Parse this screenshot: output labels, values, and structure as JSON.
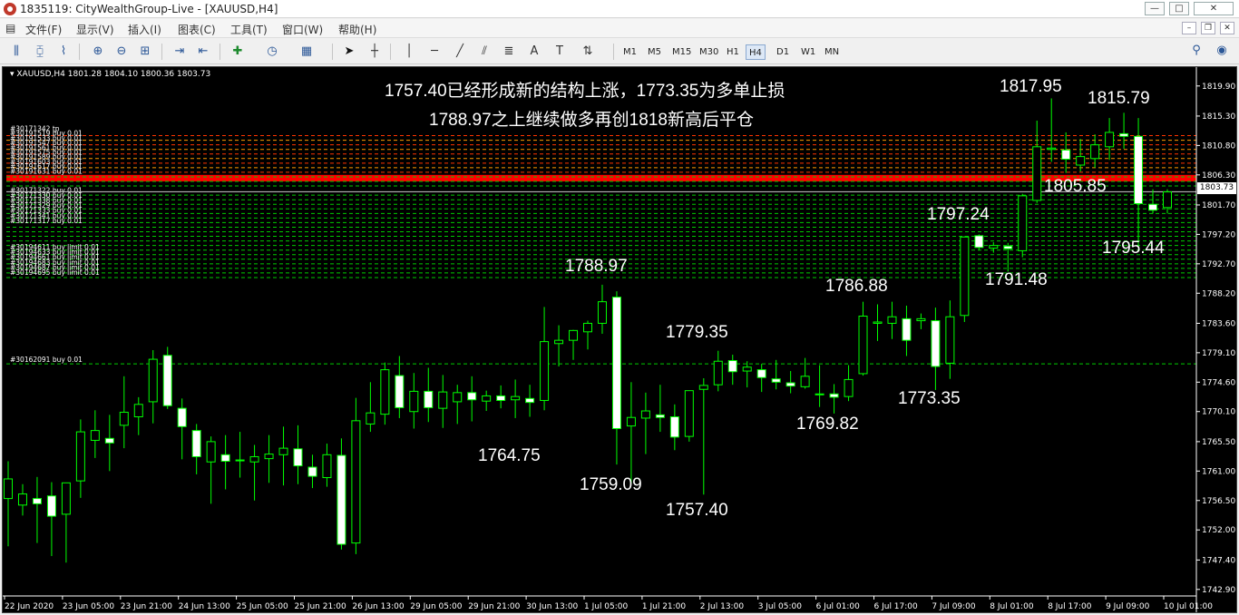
{
  "window": {
    "title": "1835119: CityWealthGroup-Live - [XAUUSD,H4]",
    "minimize_label": "—",
    "maximize_label": "□",
    "close_label": "✕"
  },
  "menu": {
    "items": [
      "文件(F)",
      "显示(V)",
      "插入(I)",
      "图表(C)",
      "工具(T)",
      "窗口(W)",
      "帮助(H)"
    ]
  },
  "toolbar": {
    "timeframes": [
      "M1",
      "M5",
      "M15",
      "M30",
      "H1",
      "H4",
      "D1",
      "W1",
      "MN"
    ],
    "active_timeframe": "H4"
  },
  "chart_header": {
    "symbol": "XAUUSD,H4",
    "ohlc": "1801.28 1804.10 1800.36 1803.73"
  },
  "current_price": "1803.73",
  "annotations": {
    "line1": "1757.40已经形成新的结构上涨，1773.35为多单止损",
    "line2": "1788.97之上继续做多再创1818新高后平仓"
  },
  "price_labels": [
    "1817.95",
    "1815.79",
    "1805.85",
    "1797.24",
    "1795.44",
    "1791.48",
    "1786.88",
    "1788.97",
    "1779.35",
    "1773.35",
    "1769.82",
    "1764.75",
    "1759.09",
    "1757.40"
  ],
  "order_lines": {
    "tp_top": "#30171342 tp",
    "sells": [
      "#30191519 buy 0.01",
      "#30191533 buy 0.01",
      "#30191547 buy 0.01",
      "#30191561 buy 0.01",
      "#30191575 buy 0.01",
      "#30191589 buy 0.01",
      "#30191603 buy 0.01",
      "#30191617 buy 0.01",
      "#30191631 buy 0.01"
    ],
    "buys": [
      "#30171322 buy 0.01",
      "#30171330 buy 0.01",
      "#30171338 buy 0.01",
      "#30171329 buy 0.01",
      "#30171333 buy 0.01",
      "#30171341 buy 0.01",
      "#30171317 buy 0.01"
    ],
    "limits": [
      "#30194611 buy limit 0.01",
      "#30194633 buy limit 0.01",
      "#30194661 buy limit 0.01",
      "#30194683 buy limit 0.01",
      "#30194687 buy limit 0.01",
      "#30194695 buy limit 0.01"
    ],
    "lone": "#30162091 buy 0.01"
  },
  "chart_data": {
    "type": "candlestick",
    "symbol": "XAUUSD",
    "timeframe": "H4",
    "ylim": [
      1742.9,
      1822.0
    ],
    "y_ticks": [
      "1819.90",
      "1815.30",
      "1810.80",
      "1806.30",
      "1801.70",
      "1797.20",
      "1792.70",
      "1788.20",
      "1783.60",
      "1779.10",
      "1774.60",
      "1770.10",
      "1765.50",
      "1761.00",
      "1756.50",
      "1752.00",
      "1747.40",
      "1742.90"
    ],
    "x_ticks": [
      "22 Jun 2020",
      "23 Jun 05:00",
      "23 Jun 21:00",
      "24 Jun 13:00",
      "25 Jun 05:00",
      "25 Jun 21:00",
      "26 Jun 13:00",
      "29 Jun 05:00",
      "29 Jun 21:00",
      "30 Jun 13:00",
      "1 Jul 05:00",
      "1 Jul 21:00",
      "2 Jul 13:00",
      "3 Jul 05:00",
      "6 Jul 01:00",
      "6 Jul 17:00",
      "7 Jul 09:00",
      "8 Jul 01:00",
      "8 Jul 17:00",
      "9 Jul 09:00",
      "10 Jul 01:00"
    ],
    "order_levels": [
      1812.3,
      1811.6,
      1810.9,
      1810.2,
      1809.5,
      1808.8,
      1808.1,
      1807.4,
      1806.7,
      1806.0,
      1805.3,
      1804.6,
      1803.2,
      1802.5,
      1801.8,
      1801.1,
      1800.4,
      1799.7,
      1799.0,
      1798.3,
      1797.6,
      1796.9,
      1796.2,
      1795.5,
      1794.8,
      1794.1,
      1793.4,
      1792.7,
      1792.0,
      1791.3,
      1790.6,
      1777.4
    ],
    "red_band": [
      1805.3,
      1806.3
    ],
    "candles": [
      {
        "o": 1756.8,
        "h": 1762.5,
        "l": 1749.5,
        "c": 1759.8
      },
      {
        "o": 1755.8,
        "h": 1759.0,
        "l": 1754.2,
        "c": 1757.5
      },
      {
        "o": 1756.8,
        "h": 1760.1,
        "l": 1750.0,
        "c": 1756.0
      },
      {
        "o": 1757.2,
        "h": 1759.3,
        "l": 1748.0,
        "c": 1754.1
      },
      {
        "o": 1754.4,
        "h": 1759.0,
        "l": 1747.0,
        "c": 1759.2
      },
      {
        "o": 1759.5,
        "h": 1768.9,
        "l": 1756.9,
        "c": 1767.0
      },
      {
        "o": 1765.7,
        "h": 1770.3,
        "l": 1763.0,
        "c": 1767.2
      },
      {
        "o": 1766.0,
        "h": 1769.6,
        "l": 1761.0,
        "c": 1765.3
      },
      {
        "o": 1768.0,
        "h": 1775.5,
        "l": 1764.5,
        "c": 1770.0
      },
      {
        "o": 1769.3,
        "h": 1772.3,
        "l": 1766.5,
        "c": 1771.2
      },
      {
        "o": 1771.6,
        "h": 1779.5,
        "l": 1768.3,
        "c": 1778.1
      },
      {
        "o": 1778.7,
        "h": 1780.0,
        "l": 1770.5,
        "c": 1771.0
      },
      {
        "o": 1770.6,
        "h": 1772.1,
        "l": 1762.8,
        "c": 1767.8
      },
      {
        "o": 1767.2,
        "h": 1768.2,
        "l": 1760.5,
        "c": 1763.2
      },
      {
        "o": 1762.4,
        "h": 1766.3,
        "l": 1756.0,
        "c": 1765.5
      },
      {
        "o": 1763.5,
        "h": 1766.5,
        "l": 1758.2,
        "c": 1762.5
      },
      {
        "o": 1762.7,
        "h": 1767.0,
        "l": 1760.0,
        "c": 1762.6
      },
      {
        "o": 1762.4,
        "h": 1765.0,
        "l": 1756.5,
        "c": 1763.2
      },
      {
        "o": 1762.9,
        "h": 1766.5,
        "l": 1759.2,
        "c": 1763.6
      },
      {
        "o": 1763.5,
        "h": 1767.8,
        "l": 1758.8,
        "c": 1764.5
      },
      {
        "o": 1764.4,
        "h": 1768.0,
        "l": 1759.0,
        "c": 1761.8
      },
      {
        "o": 1761.6,
        "h": 1763.5,
        "l": 1758.4,
        "c": 1760.2
      },
      {
        "o": 1760.0,
        "h": 1765.2,
        "l": 1758.6,
        "c": 1763.5
      },
      {
        "o": 1763.4,
        "h": 1766.0,
        "l": 1749.0,
        "c": 1749.8
      },
      {
        "o": 1750.0,
        "h": 1772.2,
        "l": 1748.3,
        "c": 1768.7
      },
      {
        "o": 1768.2,
        "h": 1774.6,
        "l": 1767.0,
        "c": 1769.9
      },
      {
        "o": 1769.7,
        "h": 1777.6,
        "l": 1768.1,
        "c": 1776.5
      },
      {
        "o": 1775.6,
        "h": 1778.6,
        "l": 1769.1,
        "c": 1770.7
      },
      {
        "o": 1770.1,
        "h": 1776.0,
        "l": 1767.5,
        "c": 1773.2
      },
      {
        "o": 1773.2,
        "h": 1776.8,
        "l": 1768.5,
        "c": 1770.7
      },
      {
        "o": 1770.6,
        "h": 1775.7,
        "l": 1767.6,
        "c": 1773.1
      },
      {
        "o": 1771.6,
        "h": 1774.2,
        "l": 1768.2,
        "c": 1773.0
      },
      {
        "o": 1773.0,
        "h": 1775.5,
        "l": 1768.6,
        "c": 1771.9
      },
      {
        "o": 1771.7,
        "h": 1773.3,
        "l": 1770.2,
        "c": 1772.5
      },
      {
        "o": 1772.5,
        "h": 1774.1,
        "l": 1770.6,
        "c": 1771.8
      },
      {
        "o": 1771.9,
        "h": 1775.0,
        "l": 1769.1,
        "c": 1772.4
      },
      {
        "o": 1772.1,
        "h": 1774.2,
        "l": 1769.3,
        "c": 1771.5
      },
      {
        "o": 1771.8,
        "h": 1786.1,
        "l": 1770.3,
        "c": 1780.8
      },
      {
        "o": 1780.5,
        "h": 1783.3,
        "l": 1777.0,
        "c": 1781.0
      },
      {
        "o": 1781.0,
        "h": 1782.6,
        "l": 1778.0,
        "c": 1782.5
      },
      {
        "o": 1782.3,
        "h": 1784.0,
        "l": 1779.6,
        "c": 1783.6
      },
      {
        "o": 1783.6,
        "h": 1789.5,
        "l": 1782.0,
        "c": 1786.9
      },
      {
        "o": 1787.6,
        "h": 1788.5,
        "l": 1762.0,
        "c": 1767.5
      },
      {
        "o": 1767.9,
        "h": 1774.6,
        "l": 1759.1,
        "c": 1769.2
      },
      {
        "o": 1769.1,
        "h": 1773.0,
        "l": 1763.6,
        "c": 1770.2
      },
      {
        "o": 1769.6,
        "h": 1774.2,
        "l": 1767.0,
        "c": 1769.2
      },
      {
        "o": 1769.3,
        "h": 1771.2,
        "l": 1764.2,
        "c": 1766.2
      },
      {
        "o": 1766.3,
        "h": 1773.0,
        "l": 1765.5,
        "c": 1773.3
      },
      {
        "o": 1773.5,
        "h": 1775.2,
        "l": 1757.4,
        "c": 1774.1
      },
      {
        "o": 1774.2,
        "h": 1779.4,
        "l": 1773.2,
        "c": 1777.8
      },
      {
        "o": 1777.9,
        "h": 1778.8,
        "l": 1774.2,
        "c": 1776.2
      },
      {
        "o": 1776.3,
        "h": 1777.8,
        "l": 1773.8,
        "c": 1776.9
      },
      {
        "o": 1776.5,
        "h": 1777.4,
        "l": 1773.1,
        "c": 1775.3
      },
      {
        "o": 1775.1,
        "h": 1778.0,
        "l": 1773.5,
        "c": 1774.6
      },
      {
        "o": 1774.5,
        "h": 1776.3,
        "l": 1772.9,
        "c": 1774.0
      },
      {
        "o": 1773.9,
        "h": 1778.3,
        "l": 1773.6,
        "c": 1775.5
      },
      {
        "o": 1772.8,
        "h": 1777.2,
        "l": 1770.8,
        "c": 1772.7
      },
      {
        "o": 1772.8,
        "h": 1774.3,
        "l": 1769.8,
        "c": 1772.3
      },
      {
        "o": 1772.4,
        "h": 1777.2,
        "l": 1771.7,
        "c": 1775.0
      },
      {
        "o": 1775.9,
        "h": 1786.9,
        "l": 1775.6,
        "c": 1784.7
      },
      {
        "o": 1783.6,
        "h": 1786.5,
        "l": 1780.9,
        "c": 1783.8
      },
      {
        "o": 1783.6,
        "h": 1786.9,
        "l": 1781.2,
        "c": 1784.6
      },
      {
        "o": 1784.3,
        "h": 1786.3,
        "l": 1778.6,
        "c": 1781.0
      },
      {
        "o": 1784.0,
        "h": 1785.1,
        "l": 1782.7,
        "c": 1784.3
      },
      {
        "o": 1784.0,
        "h": 1786.0,
        "l": 1773.4,
        "c": 1777.0
      },
      {
        "o": 1777.5,
        "h": 1787.1,
        "l": 1775.1,
        "c": 1784.6
      },
      {
        "o": 1784.8,
        "h": 1796.9,
        "l": 1783.8,
        "c": 1796.8
      },
      {
        "o": 1797.0,
        "h": 1797.2,
        "l": 1794.8,
        "c": 1795.2
      },
      {
        "o": 1795.1,
        "h": 1796.0,
        "l": 1794.4,
        "c": 1795.5
      },
      {
        "o": 1795.4,
        "h": 1795.9,
        "l": 1791.5,
        "c": 1795.0
      },
      {
        "o": 1794.7,
        "h": 1803.4,
        "l": 1793.7,
        "c": 1803.1
      },
      {
        "o": 1802.4,
        "h": 1814.6,
        "l": 1802.0,
        "c": 1810.6
      },
      {
        "o": 1810.2,
        "h": 1818.0,
        "l": 1808.3,
        "c": 1810.4
      },
      {
        "o": 1810.1,
        "h": 1812.8,
        "l": 1806.6,
        "c": 1808.7
      },
      {
        "o": 1807.8,
        "h": 1811.8,
        "l": 1806.8,
        "c": 1809.1
      },
      {
        "o": 1808.8,
        "h": 1812.5,
        "l": 1807.4,
        "c": 1810.9
      },
      {
        "o": 1810.6,
        "h": 1815.0,
        "l": 1808.6,
        "c": 1812.8
      },
      {
        "o": 1812.6,
        "h": 1815.8,
        "l": 1810.3,
        "c": 1812.2
      },
      {
        "o": 1812.2,
        "h": 1815.0,
        "l": 1795.4,
        "c": 1801.9
      },
      {
        "o": 1801.8,
        "h": 1804.1,
        "l": 1800.4,
        "c": 1800.9
      },
      {
        "o": 1801.3,
        "h": 1804.1,
        "l": 1800.4,
        "c": 1803.7
      }
    ]
  },
  "colors": {
    "background": "#000000",
    "candle_bull_fill": "#000000",
    "candle_bear_fill": "#ffffff",
    "candle_outline": "#00ff00",
    "axis_text": "#ffffff",
    "order_line_up": "#ff9900",
    "order_line_down": "#00cc00",
    "red_band": "#ff0000"
  }
}
